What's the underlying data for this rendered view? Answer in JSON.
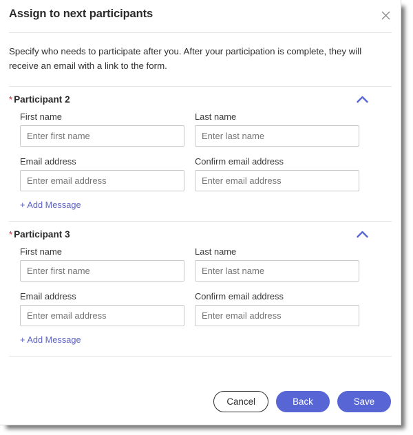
{
  "dialog": {
    "title": "Assign to next participants",
    "close_icon": "close-icon",
    "description": "Specify who needs to participate after you. After your participation is complete, they will receive an email with a link to the form.",
    "required_marker": "*",
    "collapse_icon": "chevron-up-icon",
    "accent_color": "#5865d4",
    "required_color": "#c9252d"
  },
  "participants": [
    {
      "title": "Participant 2",
      "first_name": {
        "label": "First name",
        "placeholder": "Enter first name",
        "value": ""
      },
      "last_name": {
        "label": "Last name",
        "placeholder": "Enter last name",
        "value": ""
      },
      "email": {
        "label": "Email address",
        "placeholder": "Enter email address",
        "value": ""
      },
      "confirm_email": {
        "label": "Confirm email address",
        "placeholder": "Enter email address",
        "value": ""
      },
      "add_message_label": "+ Add Message"
    },
    {
      "title": "Participant 3",
      "first_name": {
        "label": "First name",
        "placeholder": "Enter first name",
        "value": ""
      },
      "last_name": {
        "label": "Last name",
        "placeholder": "Enter last name",
        "value": ""
      },
      "email": {
        "label": "Email address",
        "placeholder": "Enter email address",
        "value": ""
      },
      "confirm_email": {
        "label": "Confirm email address",
        "placeholder": "Enter email address",
        "value": ""
      },
      "add_message_label": "+ Add Message"
    }
  ],
  "footer": {
    "cancel_label": "Cancel",
    "back_label": "Back",
    "save_label": "Save"
  }
}
